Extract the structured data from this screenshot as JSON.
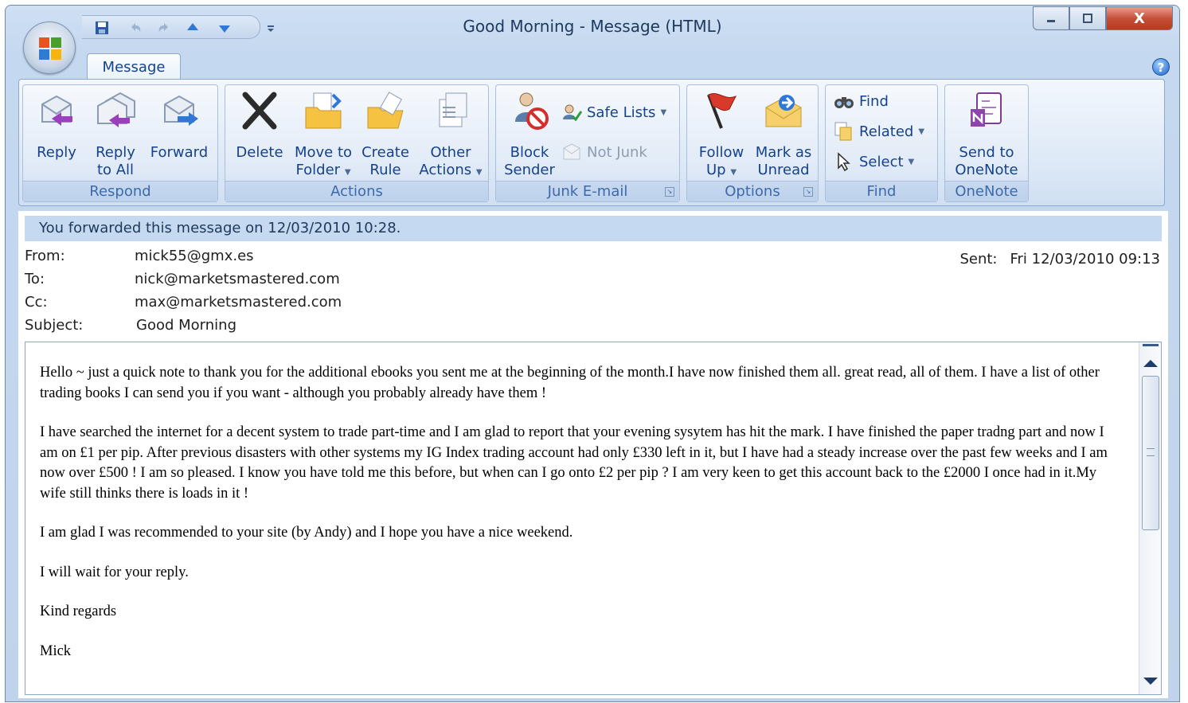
{
  "window": {
    "title": "Good Morning - Message (HTML)",
    "close_label": "X"
  },
  "tabs": [
    {
      "label": "Message"
    }
  ],
  "help_label": "?",
  "ribbon": {
    "respond": {
      "label": "Respond",
      "reply": "Reply",
      "reply_all_1": "Reply",
      "reply_all_2": "to All",
      "forward": "Forward"
    },
    "actions": {
      "label": "Actions",
      "delete": "Delete",
      "move_1": "Move to",
      "move_2": "Folder",
      "create_1": "Create",
      "create_2": "Rule",
      "other_1": "Other",
      "other_2": "Actions"
    },
    "junk": {
      "label": "Junk E-mail",
      "block_1": "Block",
      "block_2": "Sender",
      "safe_lists": "Safe Lists",
      "not_junk": "Not Junk"
    },
    "options": {
      "label": "Options",
      "follow_1": "Follow",
      "follow_2": "Up",
      "mark_1": "Mark as",
      "mark_2": "Unread"
    },
    "find": {
      "label": "Find",
      "find": "Find",
      "related": "Related",
      "select": "Select"
    },
    "onenote": {
      "label": "OneNote",
      "send_1": "Send to",
      "send_2": "OneNote"
    }
  },
  "message": {
    "info_bar": "You forwarded this message on 12/03/2010 10:28.",
    "from_label": "From:",
    "from": "mick55@gmx.es",
    "to_label": "To:",
    "to": "nick@marketsmastered.com",
    "cc_label": "Cc:",
    "cc": "max@marketsmastered.com",
    "subject_label": "Subject:",
    "subject": "Good Morning",
    "sent_label": "Sent:",
    "sent": "Fri 12/03/2010 09:13",
    "body": [
      "Hello ~ just a quick note to thank you for the additional ebooks you sent me at the beginning of the month.I have now finished them all. great read, all of them.  I have a list of other trading books I can send you if you want - although you probably already have them !",
      "I have searched the internet for a decent system to trade part-time and I am glad to report that your evening sysytem has hit the mark. I have finished the paper tradng part and now I am on £1 per pip. After previous disasters with other systems my IG Index trading account had only £330 left in it, but I have had a steady increase over the past few weeks and I am now over £500 ! I am so pleased.  I know you have told me this before, but when can I go onto £2 per pip ? I am very keen to get this account back to the £2000 I once had in it.My wife still thinks there is loads in it !",
      "I am glad I was recommended to your site (by Andy) and I hope you have a nice weekend.",
      "I will wait for your reply.",
      "Kind regards",
      "Mick"
    ]
  }
}
